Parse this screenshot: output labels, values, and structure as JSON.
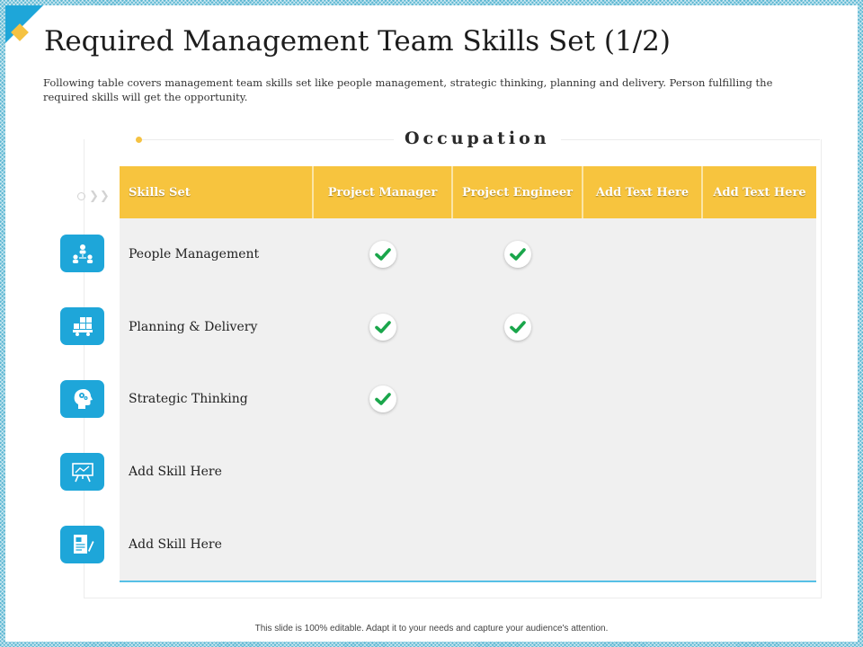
{
  "slide": {
    "title": "Required Management Team Skills Set (1/2)",
    "subtitle": "Following table covers management  team skills set like people management,  strategic thinking, planning and delivery. Person fulfilling the required skills will get the opportunity.",
    "section_heading": "Occupation",
    "footer": "This slide is 100% editable.  Adapt it to your needs and capture your audience's attention."
  },
  "table": {
    "headers": [
      "Skills Set",
      "Project Manager",
      "Project Engineer",
      "Add Text Here",
      "Add Text Here"
    ],
    "rows": [
      {
        "skill": "People Management",
        "icon": "team-hierarchy-icon",
        "checks": [
          true,
          true,
          false,
          false
        ]
      },
      {
        "skill": "Planning & Delivery",
        "icon": "delivery-truck-icon",
        "checks": [
          true,
          true,
          false,
          false
        ]
      },
      {
        "skill": "Strategic Thinking",
        "icon": "head-gears-icon",
        "checks": [
          true,
          false,
          false,
          false
        ]
      },
      {
        "skill": "Add Skill Here",
        "icon": "presentation-board-icon",
        "checks": [
          false,
          false,
          false,
          false
        ]
      },
      {
        "skill": "Add Skill Here",
        "icon": "document-pen-icon",
        "checks": [
          false,
          false,
          false,
          false
        ]
      }
    ]
  },
  "colors": {
    "accent_blue": "#1ea6d9",
    "header_yellow": "#f7c43e",
    "check_green": "#1aa64b",
    "row_bg": "#f0f0f0"
  }
}
